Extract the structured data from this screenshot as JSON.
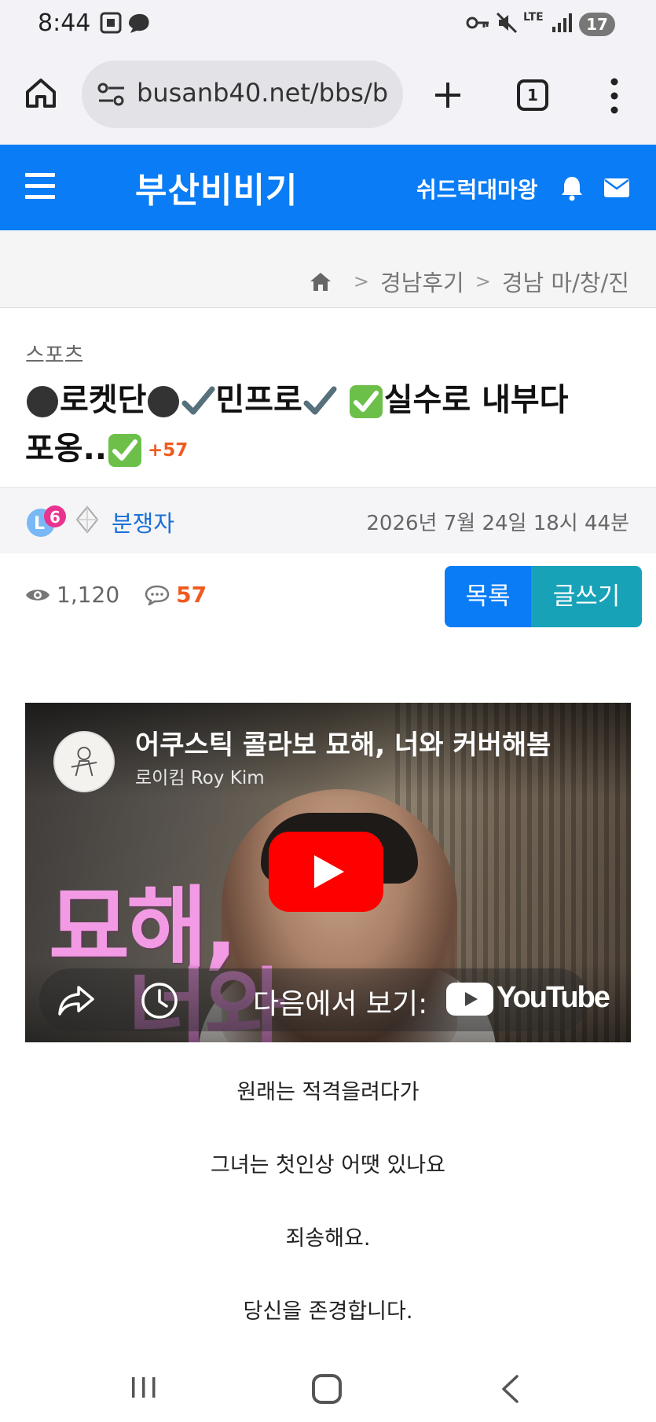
{
  "status_bar": {
    "time": "8:44",
    "battery": "17",
    "network": "LTE"
  },
  "browser": {
    "url": "busanb40.net/bbs/b",
    "tab_count": "1"
  },
  "site_header": {
    "title": "부산비비기",
    "username": "쉬드럭대마왕",
    "color": "#0a7cf5"
  },
  "breadcrumb": {
    "items": [
      "경남후기",
      "경남 마/창/진"
    ],
    "separator": ">"
  },
  "post": {
    "category": "스포츠",
    "title_parts": [
      "로켓단",
      "민프로",
      "실수로 내부다",
      "포옹.."
    ],
    "comment_badge": "+57",
    "author": "분쟁자",
    "date": "2026년 7월 24일 18시 44분",
    "views": "1,120",
    "replies": "57"
  },
  "actions": {
    "list_label": "목록",
    "write_label": "글쓰기"
  },
  "video": {
    "title": "어쿠스틱 콜라보 묘해, 너와 커버해봄",
    "channel": "로이킴 Roy Kim",
    "thumb_text_1": "묘해,",
    "thumb_text_2": "너와",
    "watch_on": "다음에서 보기:",
    "brand": "YouTube"
  },
  "body_lines": [
    "원래는 적격을려다가",
    "그녀는 첫인상 어땟 있나요",
    "죄송해요.",
    "당신을 존경합니다."
  ]
}
